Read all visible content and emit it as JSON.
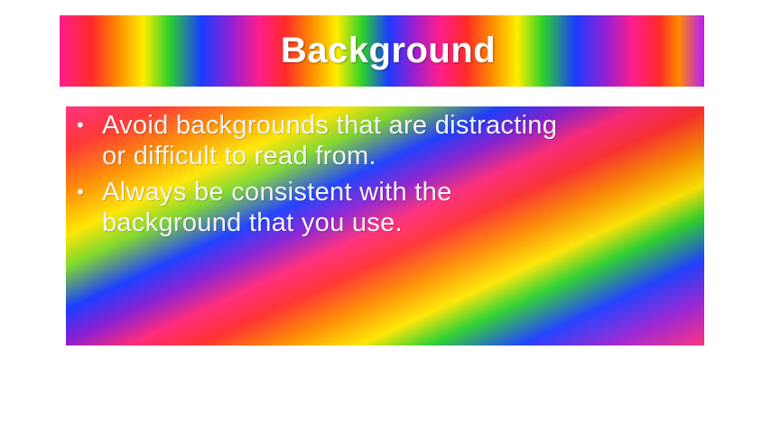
{
  "slide": {
    "title": "Background",
    "bullets": [
      {
        "line1": "Avoid backgrounds that are distracting",
        "line2": "or difficult to read from."
      },
      {
        "line1": "Always be consistent with the",
        "line2": "background that you use."
      }
    ],
    "bullet_marker": "•"
  },
  "colors": {
    "background": "#ffffff",
    "title_text": "#ffffff",
    "body_text": "#f4f4f4",
    "rainbow": [
      "#ff1e8c",
      "#ff2a2a",
      "#ff8a00",
      "#ffee00",
      "#2bd12b",
      "#1a3cff",
      "#9b1fd1"
    ]
  }
}
